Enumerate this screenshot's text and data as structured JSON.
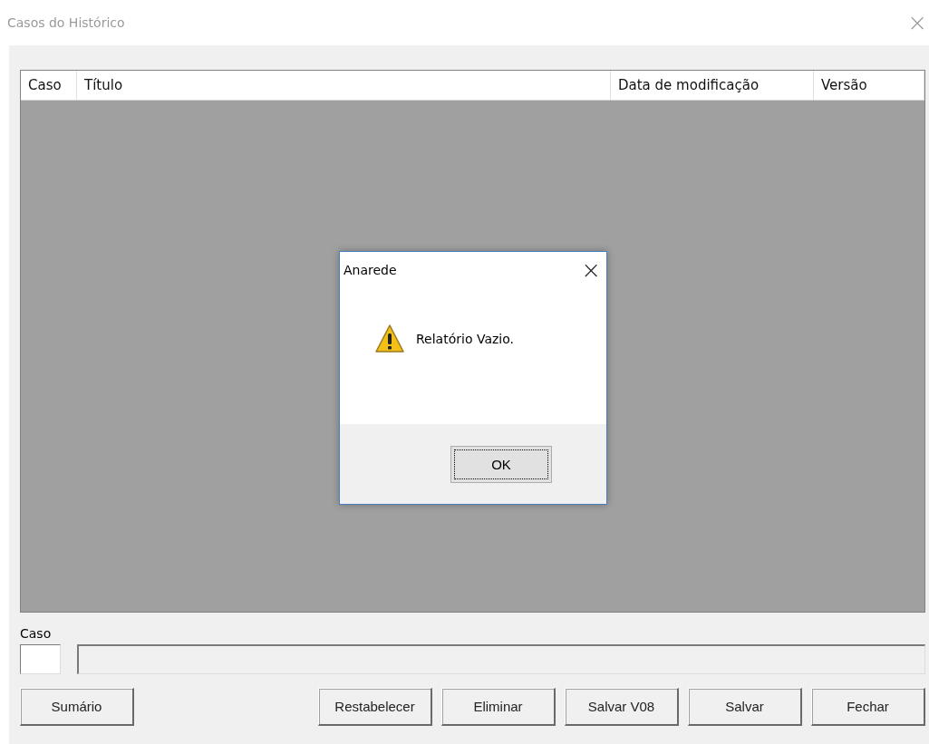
{
  "window": {
    "title": "Casos do Histórico",
    "close": "×"
  },
  "table": {
    "columns": [
      "Caso",
      "Título",
      "Data de modificação",
      "Versão"
    ]
  },
  "case_label": "Caso",
  "left_buttons": [
    "Sumário"
  ],
  "right_buttons": [
    "Restabelecer",
    "Eliminar",
    "Salvar V08",
    "Salvar",
    "Fechar"
  ],
  "dialog": {
    "title": "Anarede",
    "close": "×",
    "message": "Relatório Vazio.",
    "buttons": [
      {
        "label": "OK",
        "focused": true
      }
    ]
  }
}
